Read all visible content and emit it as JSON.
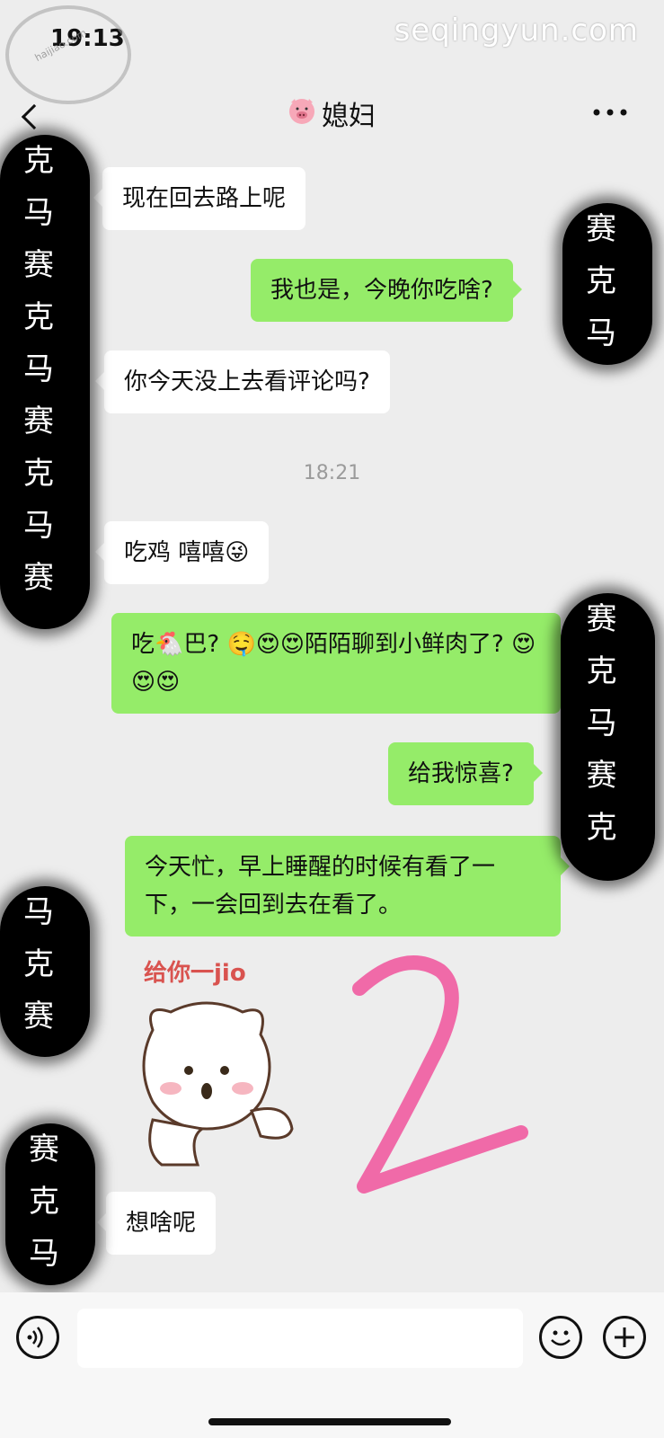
{
  "status_bar": {
    "time": "19:13"
  },
  "watermark": {
    "site": "seqingyun.com",
    "stamp": "haijiao.com"
  },
  "header": {
    "title": "媳妇",
    "back_icon": "chevron-left-icon",
    "title_icon": "pig-face-icon",
    "more_icon": "more-dots-icon"
  },
  "messages": [
    {
      "direction": "incoming",
      "text": "现在回去路上呢"
    },
    {
      "direction": "outgoing",
      "text": "我也是，今晚你吃啥?"
    },
    {
      "direction": "incoming",
      "text": "你今天没上去看评论吗?"
    },
    {
      "direction": "incoming",
      "text": "吃鸡 嘻嘻😜"
    },
    {
      "direction": "outgoing",
      "text": "吃🐔巴? 🤤😍😍陌陌聊到小鲜肉了? 😍😍😍"
    },
    {
      "direction": "outgoing",
      "text": "给我惊喜?"
    },
    {
      "direction": "outgoing",
      "text": "今天忙，早上睡醒的时候有看了一下，一会回到去在看了。"
    },
    {
      "direction": "incoming",
      "text": "想啥呢"
    }
  ],
  "timestamp": "18:21",
  "sticker": {
    "label": "给你一jio",
    "icon": "kicking-bear-sticker"
  },
  "censor_mark": [
    "克",
    "马",
    "赛"
  ],
  "annotation": {
    "icon": "pink-handwritten-two"
  },
  "input_bar": {
    "voice_icon": "voice-icon",
    "emoji_icon": "emoji-icon",
    "plus_icon": "plus-icon",
    "input_value": ""
  },
  "colors": {
    "background": "#ededed",
    "outgoing_bubble": "#95ec69",
    "incoming_bubble": "#ffffff",
    "annotation": "#f06aa8"
  }
}
